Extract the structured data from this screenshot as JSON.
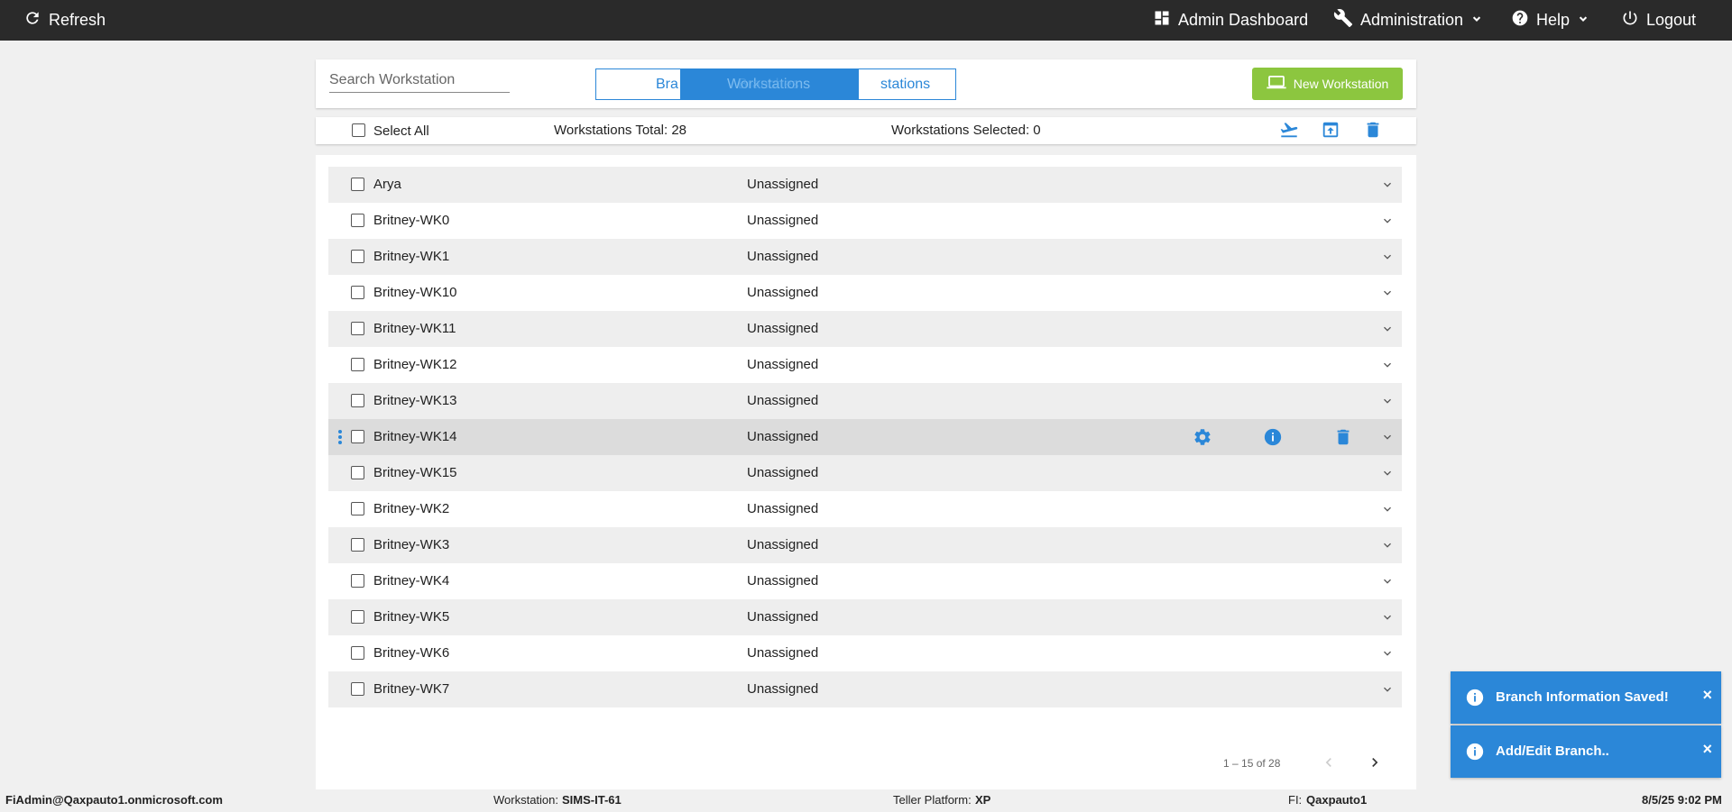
{
  "topbar": {
    "refresh": "Refresh",
    "admin_dashboard": "Admin Dashboard",
    "administration": "Administration",
    "help": "Help",
    "logout": "Logout"
  },
  "toolbar": {
    "search_placeholder": "Search Workstation",
    "toggle_left": "Bra",
    "toggle_active": "Workstations",
    "toggle_active_ghost": "Branches",
    "toggle_right": "stations",
    "new_button": "New Workstation"
  },
  "summary": {
    "select_all": "Select All",
    "total": "Workstations Total: 28",
    "selected": "Workstations Selected: 0"
  },
  "rows": [
    {
      "name": "Arya",
      "assignment": "Unassigned"
    },
    {
      "name": "Britney-WK0",
      "assignment": "Unassigned"
    },
    {
      "name": "Britney-WK1",
      "assignment": "Unassigned"
    },
    {
      "name": "Britney-WK10",
      "assignment": "Unassigned"
    },
    {
      "name": "Britney-WK11",
      "assignment": "Unassigned"
    },
    {
      "name": "Britney-WK12",
      "assignment": "Unassigned"
    },
    {
      "name": "Britney-WK13",
      "assignment": "Unassigned"
    },
    {
      "name": "Britney-WK14",
      "assignment": "Unassigned"
    },
    {
      "name": "Britney-WK15",
      "assignment": "Unassigned"
    },
    {
      "name": "Britney-WK2",
      "assignment": "Unassigned"
    },
    {
      "name": "Britney-WK3",
      "assignment": "Unassigned"
    },
    {
      "name": "Britney-WK4",
      "assignment": "Unassigned"
    },
    {
      "name": "Britney-WK5",
      "assignment": "Unassigned"
    },
    {
      "name": "Britney-WK6",
      "assignment": "Unassigned"
    },
    {
      "name": "Britney-WK7",
      "assignment": "Unassigned"
    }
  ],
  "hovered_row_index": 7,
  "pager": {
    "range": "1 – 15 of 28"
  },
  "footer": {
    "user": "FiAdmin@Qaxpauto1.onmicrosoft.com",
    "workstation_label": "Workstation:",
    "workstation_value": "SIMS-IT-61",
    "platform_label": "Teller Platform:",
    "platform_value": "XP",
    "fi_label": "FI:",
    "fi_value": "Qaxpauto1",
    "datetime": "8/5/25 9:02 PM"
  },
  "toasts": [
    {
      "text": "Branch Information Saved!",
      "close": "×"
    },
    {
      "text": "Add/Edit Branch..",
      "close": "×"
    }
  ],
  "colors": {
    "accent": "#2b87d8",
    "new_button": "#8cc63f",
    "topbar": "#2a2a2a"
  }
}
